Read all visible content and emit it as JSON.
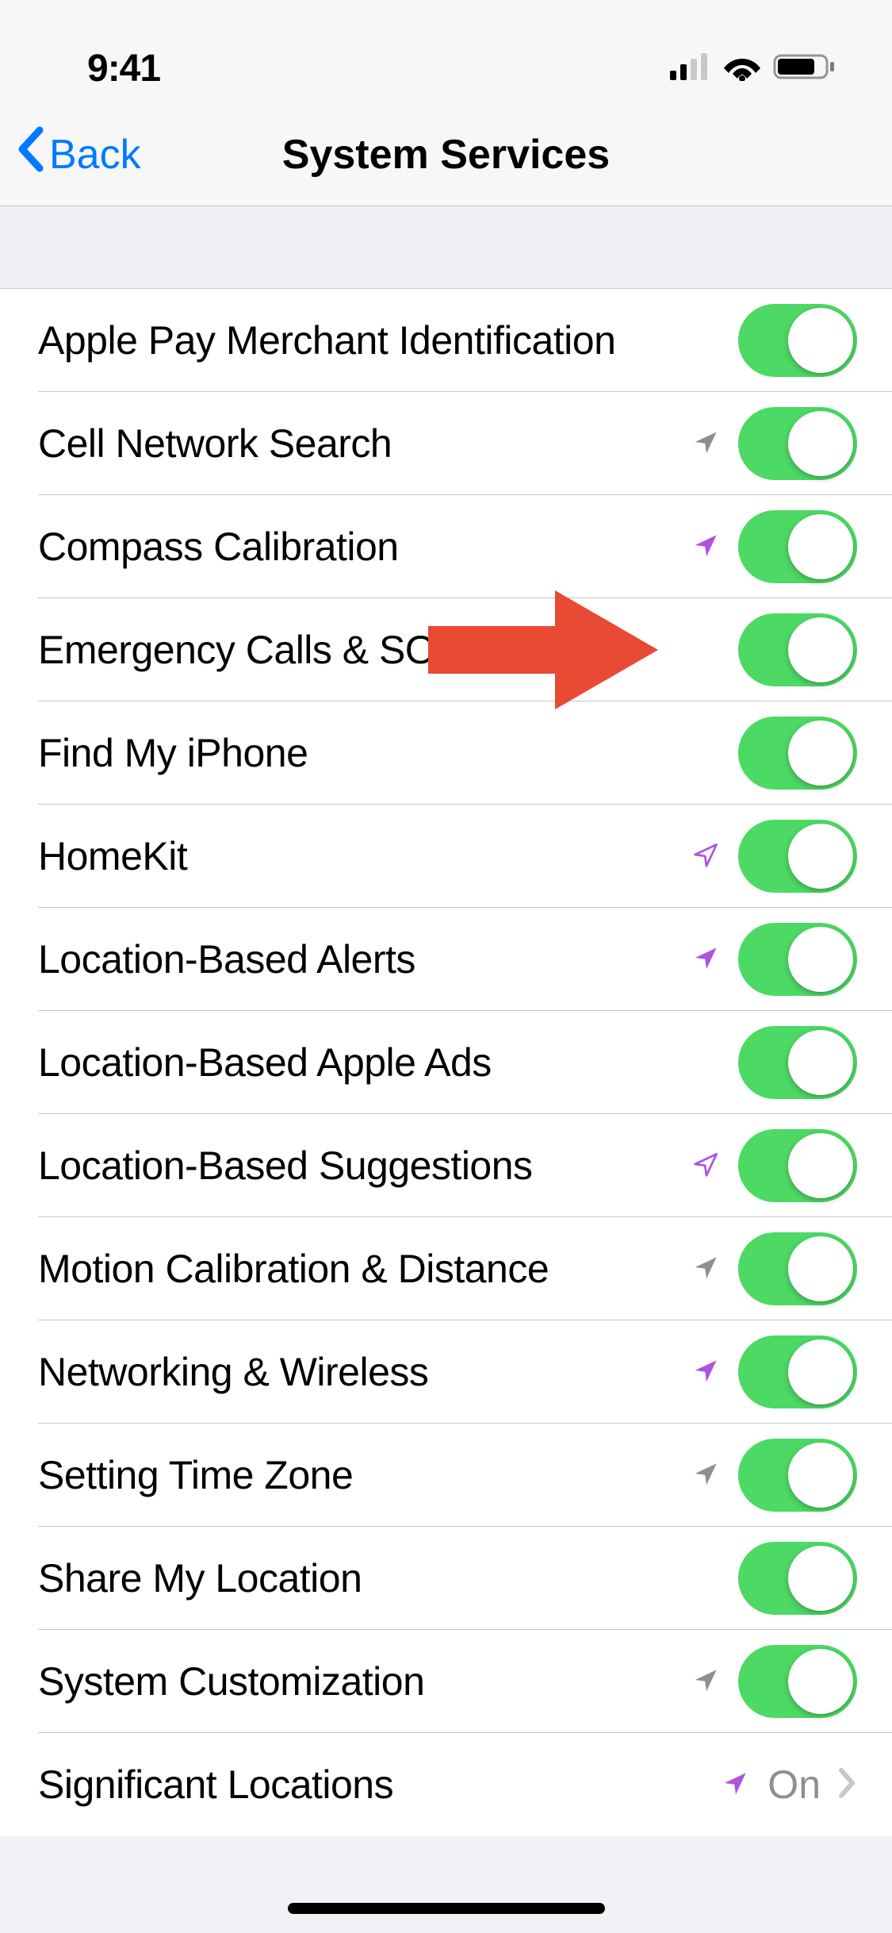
{
  "status": {
    "time": "9:41"
  },
  "nav": {
    "back_label": "Back",
    "title": "System Services"
  },
  "rows": [
    {
      "label": "Apple Pay Merchant Identification",
      "arrow": "none",
      "control": "switch",
      "on": true
    },
    {
      "label": "Cell Network Search",
      "arrow": "gray",
      "control": "switch",
      "on": true
    },
    {
      "label": "Compass Calibration",
      "arrow": "purple",
      "control": "switch",
      "on": true
    },
    {
      "label": "Emergency Calls & SOS",
      "arrow": "none",
      "control": "switch",
      "on": true,
      "highlighted": true
    },
    {
      "label": "Find My iPhone",
      "arrow": "none",
      "control": "switch",
      "on": true
    },
    {
      "label": "HomeKit",
      "arrow": "purple-outline",
      "control": "switch",
      "on": true
    },
    {
      "label": "Location-Based Alerts",
      "arrow": "purple",
      "control": "switch",
      "on": true
    },
    {
      "label": "Location-Based Apple Ads",
      "arrow": "none",
      "control": "switch",
      "on": true
    },
    {
      "label": "Location-Based Suggestions",
      "arrow": "purple-outline",
      "control": "switch",
      "on": true
    },
    {
      "label": "Motion Calibration & Distance",
      "arrow": "gray",
      "control": "switch",
      "on": true
    },
    {
      "label": "Networking & Wireless",
      "arrow": "purple",
      "control": "switch",
      "on": true
    },
    {
      "label": "Setting Time Zone",
      "arrow": "gray",
      "control": "switch",
      "on": true
    },
    {
      "label": "Share My Location",
      "arrow": "none",
      "control": "switch",
      "on": true
    },
    {
      "label": "System Customization",
      "arrow": "gray",
      "control": "switch",
      "on": true
    },
    {
      "label": "Significant Locations",
      "arrow": "purple",
      "control": "disclosure",
      "value": "On"
    }
  ],
  "colors": {
    "accent": "#007aff",
    "switch_on": "#4cd964",
    "arrow_gray": "#8e8e93",
    "arrow_purple": "#af52de",
    "annotation_red": "#e94a33"
  }
}
